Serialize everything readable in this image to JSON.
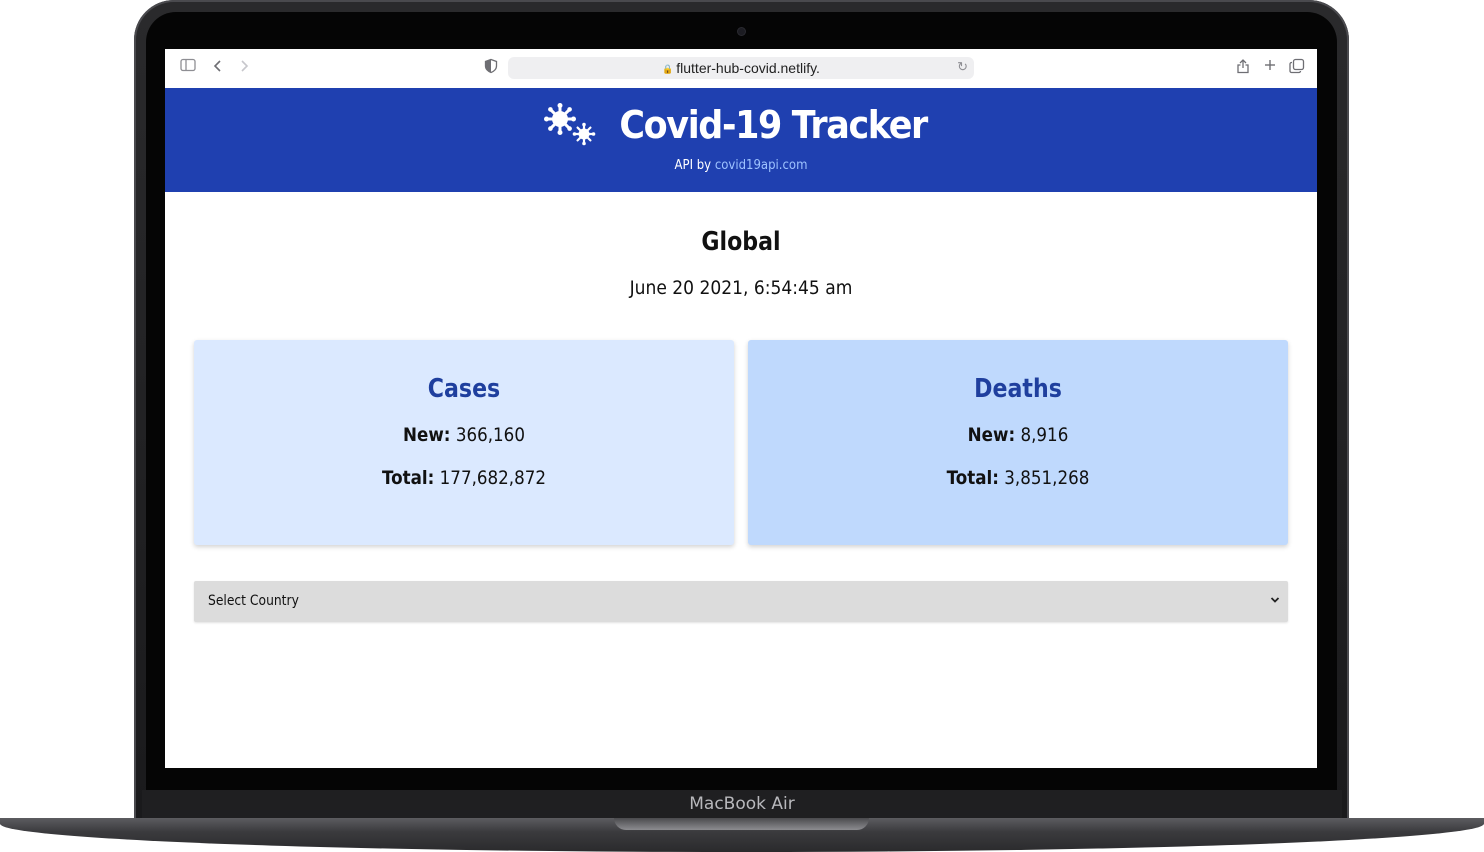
{
  "browser": {
    "url": "flutter-hub-covid.netlify.",
    "icons": [
      "sidebar-icon",
      "back-icon",
      "forward-icon",
      "shield-icon",
      "lock-icon",
      "reload-icon",
      "share-icon",
      "new-tab-icon",
      "tabs-icon"
    ]
  },
  "header": {
    "title": "Covid-19 Tracker",
    "api_prefix": "API by",
    "api_link": "covid19api.com",
    "background_color": "#1f40b0"
  },
  "summary": {
    "title": "Global",
    "date": "June 20 2021, 6:54:45 am"
  },
  "cards": {
    "cases": {
      "title": "Cases",
      "new_label": "New:",
      "new_value": "366,160",
      "total_label": "Total:",
      "total_value": "177,682,872",
      "color": "#dbe9ff"
    },
    "deaths": {
      "title": "Deaths",
      "new_label": "New:",
      "new_value": "8,916",
      "total_label": "Total:",
      "total_value": "3,851,268",
      "color": "#bfd9fd"
    }
  },
  "country_select": {
    "selected": "Select Country"
  },
  "device": {
    "label": "MacBook Air"
  }
}
